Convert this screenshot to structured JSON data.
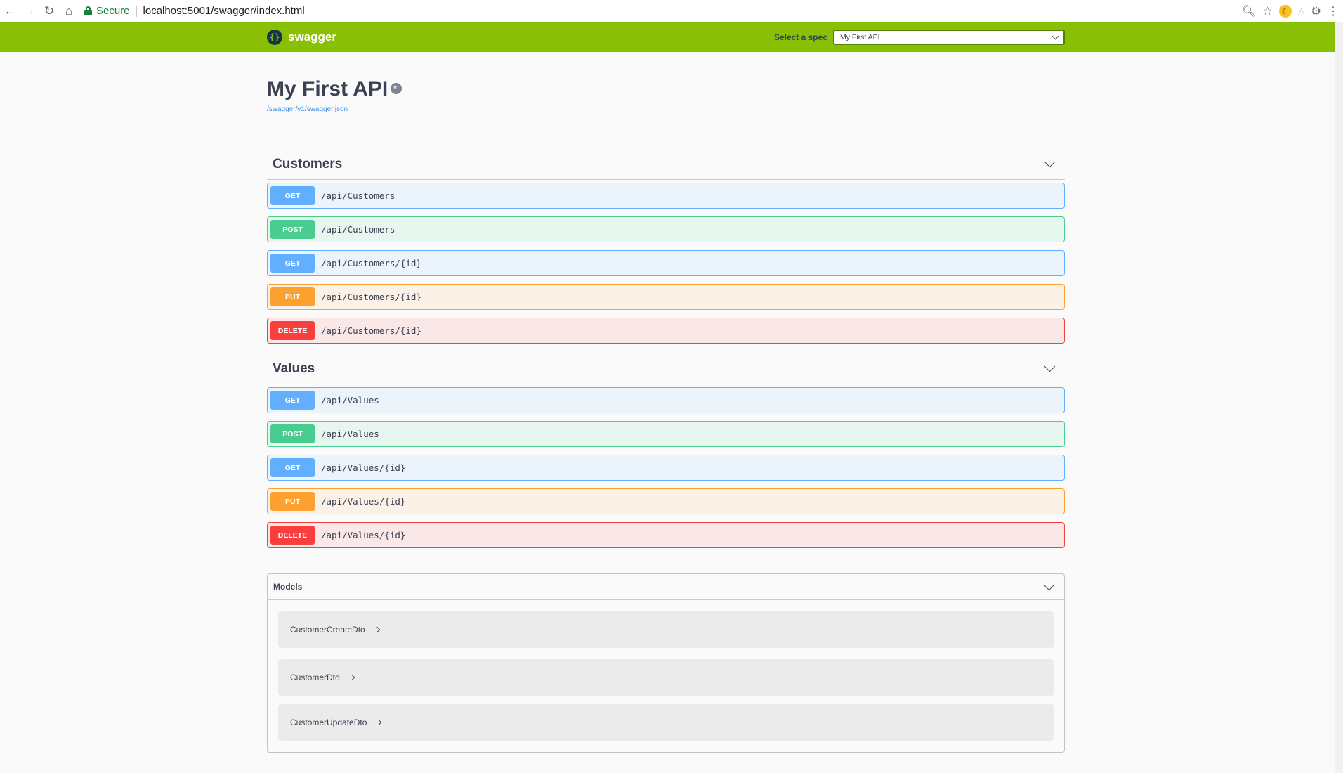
{
  "browser": {
    "secure_label": "Secure",
    "url": "localhost:5001/swagger/index.html"
  },
  "topbar": {
    "brand": "swagger",
    "spec_label": "Select a spec",
    "spec_value": "My First API"
  },
  "info": {
    "title": "My First API",
    "version": "v1",
    "json_link": "/swagger/v1/swagger.json"
  },
  "tags": [
    {
      "name": "Customers",
      "operations": [
        {
          "method": "GET",
          "path": "/api/Customers"
        },
        {
          "method": "POST",
          "path": "/api/Customers"
        },
        {
          "method": "GET",
          "path": "/api/Customers/{id}"
        },
        {
          "method": "PUT",
          "path": "/api/Customers/{id}"
        },
        {
          "method": "DELETE",
          "path": "/api/Customers/{id}"
        }
      ]
    },
    {
      "name": "Values",
      "operations": [
        {
          "method": "GET",
          "path": "/api/Values"
        },
        {
          "method": "POST",
          "path": "/api/Values"
        },
        {
          "method": "GET",
          "path": "/api/Values/{id}"
        },
        {
          "method": "PUT",
          "path": "/api/Values/{id}"
        },
        {
          "method": "DELETE",
          "path": "/api/Values/{id}"
        }
      ]
    }
  ],
  "models": {
    "title": "Models",
    "items": [
      "CustomerCreateDto",
      "CustomerDto",
      "CustomerUpdateDto"
    ]
  },
  "colors": {
    "topbar": "#89bf04",
    "get": "#61affe",
    "post": "#49cc90",
    "put": "#fca130",
    "delete": "#f93e3e"
  }
}
